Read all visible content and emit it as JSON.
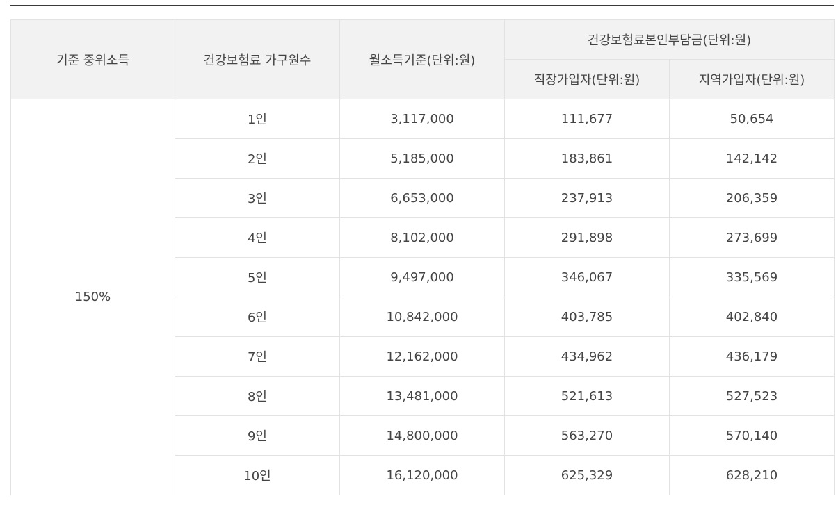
{
  "table": {
    "headers": {
      "median_income": "기준 중위소득",
      "household_members": "건강보험료 가구원수",
      "monthly_income": "월소득기준(단위:원)",
      "personal_share": "건강보험료본인부담금(단위:원)",
      "employee": "직장가입자(단위:원)",
      "regional": "지역가입자(단위:원)"
    },
    "median_value": "150%",
    "rows": [
      {
        "members": "1인",
        "income": "3,117,000",
        "employee": "111,677",
        "regional": "50,654"
      },
      {
        "members": "2인",
        "income": "5,185,000",
        "employee": "183,861",
        "regional": "142,142"
      },
      {
        "members": "3인",
        "income": "6,653,000",
        "employee": "237,913",
        "regional": "206,359"
      },
      {
        "members": "4인",
        "income": "8,102,000",
        "employee": "291,898",
        "regional": "273,699"
      },
      {
        "members": "5인",
        "income": "9,497,000",
        "employee": "346,067",
        "regional": "335,569"
      },
      {
        "members": "6인",
        "income": "10,842,000",
        "employee": "403,785",
        "regional": "402,840"
      },
      {
        "members": "7인",
        "income": "12,162,000",
        "employee": "434,962",
        "regional": "436,179"
      },
      {
        "members": "8인",
        "income": "13,481,000",
        "employee": "521,613",
        "regional": "527,523"
      },
      {
        "members": "9인",
        "income": "14,800,000",
        "employee": "563,270",
        "regional": "570,140"
      },
      {
        "members": "10인",
        "income": "16,120,000",
        "employee": "625,329",
        "regional": "628,210"
      }
    ]
  }
}
